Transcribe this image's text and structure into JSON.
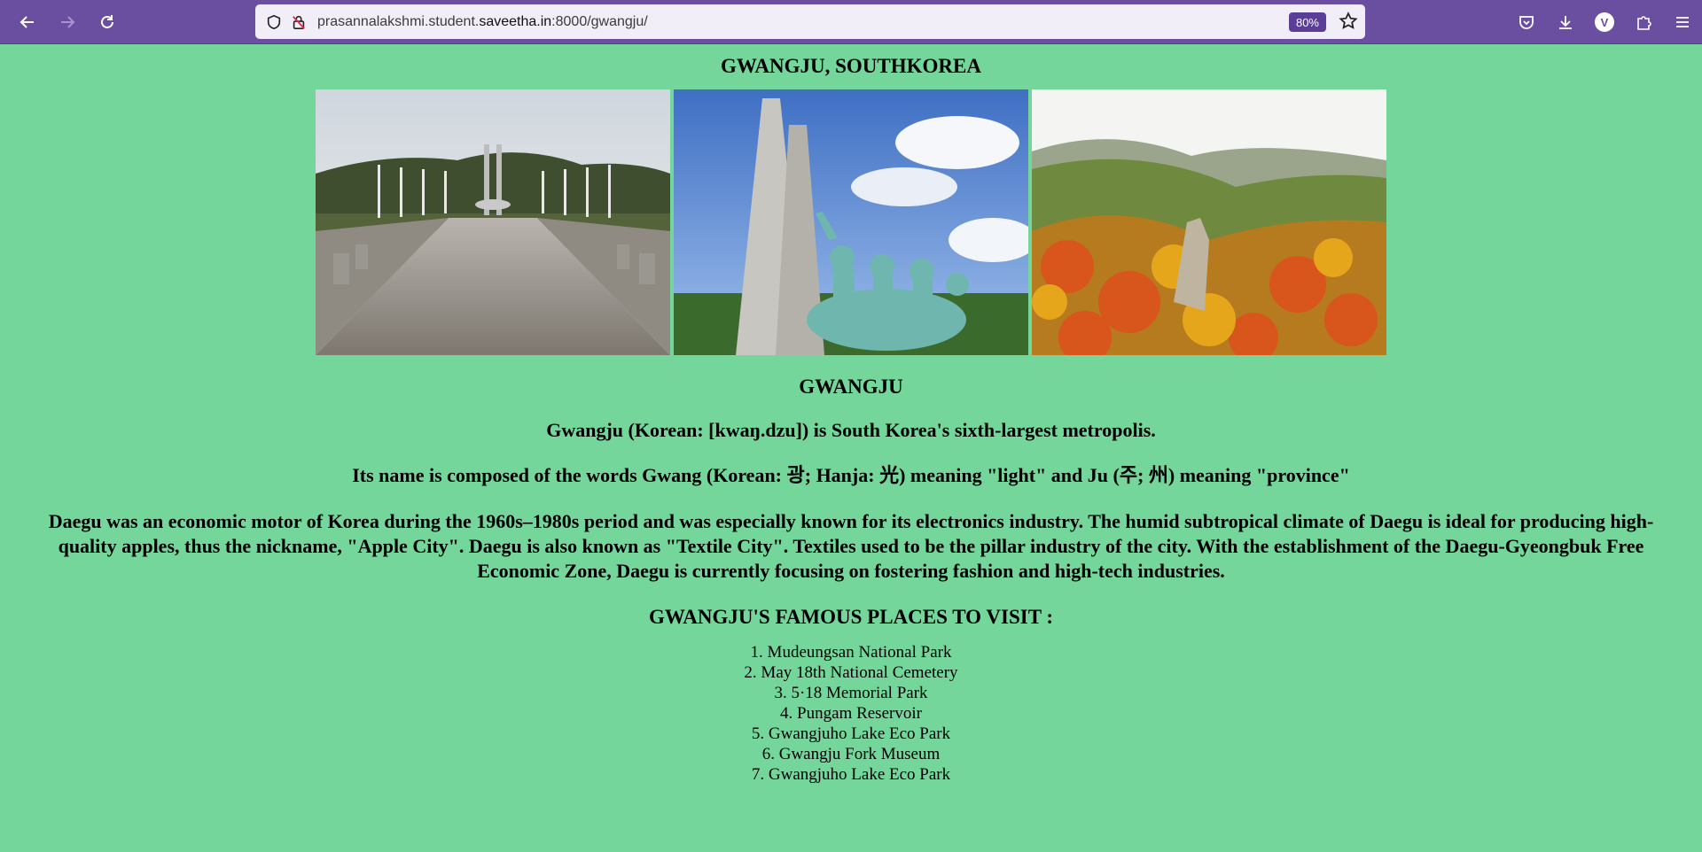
{
  "browser": {
    "url_prefix": "prasannalakshmi.student.",
    "url_host": "saveetha.in",
    "url_suffix": ":8000/gwangju/",
    "zoom": "80%",
    "avatar_letter": "V"
  },
  "page": {
    "title": "GWANGJU, SOUTHKOREA",
    "images": [
      {
        "alt": "May 18th National Cemetery plaza",
        "icon": "cemetery-photo"
      },
      {
        "alt": "5·18 Memorial tower and statues",
        "icon": "memorial-photo"
      },
      {
        "alt": "Mudeungsan autumn mountains",
        "icon": "mountain-photo"
      }
    ],
    "subtitle": "GWANGJU",
    "intro": "Gwangju (Korean: [kwaŋ.dzu]) is South Korea's sixth-largest metropolis.",
    "name_origin": "Its name is composed of the words Gwang (Korean: 광; Hanja: 光) meaning \"light\" and Ju (주; 州) meaning \"province\"",
    "paragraph": "Daegu was an economic motor of Korea during the 1960s–1980s period and was especially known for its electronics industry. The humid subtropical climate of Daegu is ideal for producing high-quality apples, thus the nickname, \"Apple City\". Daegu is also known as \"Textile City\". Textiles used to be the pillar industry of the city. With the establishment of the Daegu-Gyeongbuk Free Economic Zone, Daegu is currently focusing on fostering fashion and high-tech industries.",
    "places_title": "GWANGJU'S FAMOUS PLACES TO VISIT :",
    "places": [
      "1. Mudeungsan National Park",
      "2. May 18th National Cemetery",
      "3. 5·18 Memorial Park",
      "4. Pungam Reservoir",
      "5. Gwangjuho Lake Eco Park",
      "6. Gwangju Fork Museum",
      "7. Gwangjuho Lake Eco Park"
    ]
  }
}
